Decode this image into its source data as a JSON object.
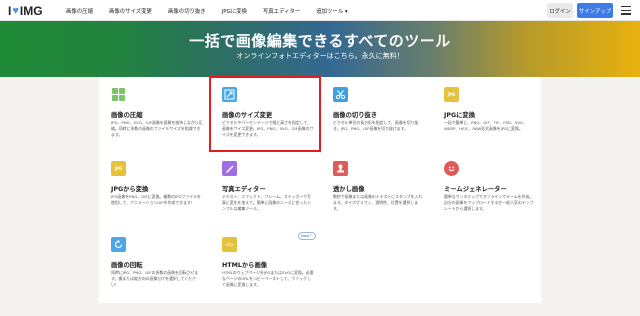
{
  "header": {
    "logo_prefix": "I",
    "logo_heart": "♥",
    "logo_suffix": "IMG",
    "nav": [
      {
        "label": "画像の圧縮"
      },
      {
        "label": "画像のサイズ変更"
      },
      {
        "label": "画像の切り抜き"
      },
      {
        "label": "JPGに変換"
      },
      {
        "label": "写真エディター"
      },
      {
        "label": "追加ツール ▾"
      }
    ],
    "login_label": "ログイン",
    "signup_label": "サインアップ"
  },
  "hero": {
    "title": "一括で画像編集できるすべてのツール",
    "subtitle": "オンラインフォトエディターはこちら。永久に無料！"
  },
  "tools": [
    {
      "title": "画像の圧縮",
      "desc": "JPG、PNG、SVG、GIF画像を画質を維持しながら圧縮。同時に多数の画像のファイルサイズを削減できます。",
      "icon": "grid-icon",
      "color": "#7cc46b"
    },
    {
      "title": "画像のサイズ変更",
      "desc": "ピクセルやパーセンテージで幅と高さを指定して、画像をサイズ変更。JPG、PNG、SVG、GIF画像のサイズを変更できます。",
      "icon": "resize-icon",
      "color": "#4aa8e8"
    },
    {
      "title": "画像の切り抜き",
      "desc": "ピクセル単位の長方形を指定して、画像を切り抜き。JPG、PNG、GIF画像を切り抜けます。",
      "icon": "scissors-icon",
      "color": "#3d9fe6"
    },
    {
      "title": "JPGに変換",
      "desc": "一括で簡単に、PNG、GIF、TIF、PSD、SVG、WEBP、HEIC、RAW形式画像をJPGに変換。",
      "icon": "jpg-icon",
      "color": "#e6c23a"
    },
    {
      "title": "JPGから変換",
      "desc": "JPG画像をPNG、GIFに変換。複数のJPGファイルを使用して、アニメーションGIFを作成できます！",
      "icon": "from-jpg-icon",
      "color": "#e6c23a"
    },
    {
      "title": "写真エディター",
      "desc": "テキスト、エフェクト、フレーム、ステッカーで写真に変化を加えて。簡単に画像のニーズに合ったシンプルな編集ツール。",
      "icon": "brush-icon",
      "color": "#a06ee0"
    },
    {
      "title": "透かし画像",
      "desc": "数秒で画像または画像のテキストにスタンプを入れます。タイポグラフィ、透明性、位置を選択します。",
      "icon": "stamp-icon",
      "color": "#e05a5a"
    },
    {
      "title": "ミームジェネレーター",
      "desc": "簡単なワンステップでオンラインでミームを作成。自分の画像をアップロードするか一般人気のテンプレートから選択します。",
      "icon": "meme-icon",
      "color": "#e05a5a"
    },
    {
      "title": "画像の回転",
      "desc": "同時にJPG、PNG、GIFの多数の画像を回転させます。横または縦方向の画像だけを選択してください！",
      "icon": "rotate-icon",
      "color": "#4aa8e8"
    },
    {
      "title": "HTMLから画像",
      "desc": "HTMLのウェブページをJPGまたはSVGに変換。必要なページのURLをコピーペーストして、クリックして画像に変換します。",
      "icon": "html-icon",
      "color": "#e6c23a",
      "badge": "New！"
    }
  ]
}
